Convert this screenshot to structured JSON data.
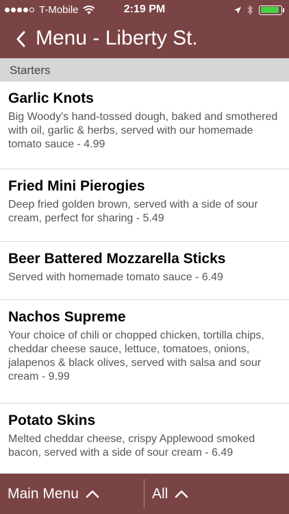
{
  "status_bar": {
    "carrier": "T-Mobile",
    "time": "2:19 PM",
    "signal_bars": 4,
    "battery_level": 0.9,
    "battery_color": "#46d246"
  },
  "nav": {
    "back_icon": "chevron-left-icon",
    "title": "Menu - Liberty St."
  },
  "section": {
    "title": "Starters"
  },
  "items": [
    {
      "name": "Garlic Knots",
      "description": "Big Woody's hand-tossed dough, baked and smothered with oil, garlic & herbs, served with our homemade tomato sauce - 4.99"
    },
    {
      "name": "Fried Mini Pierogies",
      "description": "Deep fried golden brown, served with a side of sour cream, perfect for sharing - 5.49"
    },
    {
      "name": "Beer Battered Mozzarella Sticks",
      "description": "Served with homemade tomato sauce - 6.49"
    },
    {
      "name": "Nachos Supreme",
      "description": "Your choice of chili or chopped chicken, tortilla chips, cheddar cheese sauce, lettuce, tomatoes, onions, jalapenos & black olives, served with salsa and sour cream - 9.99"
    },
    {
      "name": "Potato Skins",
      "description": "Melted cheddar cheese, crispy Applewood smoked bacon, served with a side of sour cream - 6.49"
    }
  ],
  "tabbar": {
    "main_menu_label": "Main Menu",
    "all_label": "All"
  },
  "colors": {
    "brand": "#7a4445",
    "section_bg": "#d6d6d6"
  }
}
